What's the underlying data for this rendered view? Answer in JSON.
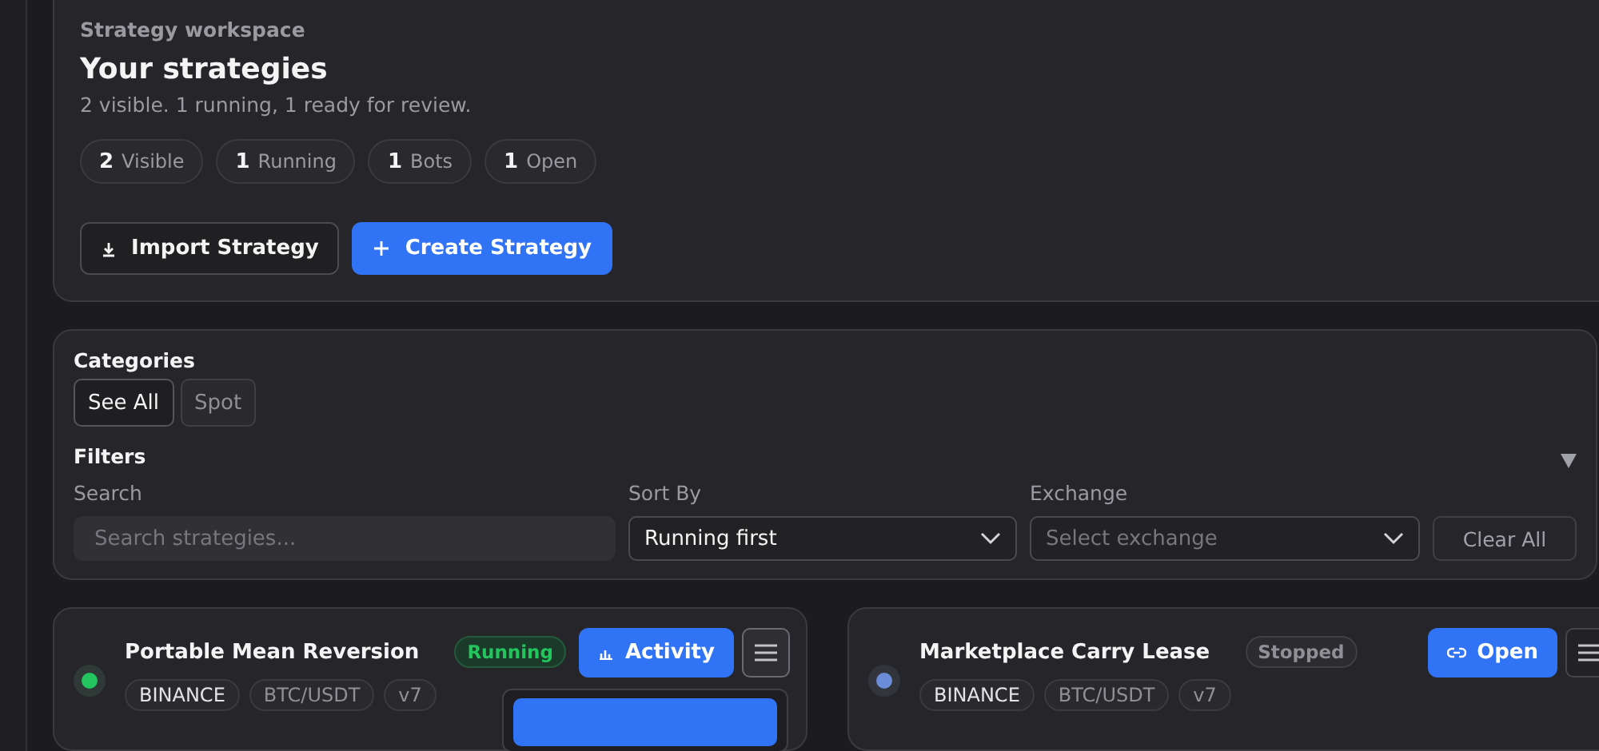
{
  "header": {
    "eyebrow": "Strategy workspace",
    "title": "Your strategies",
    "subtitle": "2 visible. 1 running, 1 ready for review.",
    "stats": [
      {
        "count": "2",
        "label": "Visible"
      },
      {
        "count": "1",
        "label": "Running"
      },
      {
        "count": "1",
        "label": "Bots"
      },
      {
        "count": "1",
        "label": "Open"
      }
    ],
    "buttons": [
      {
        "label": "Import Strategy",
        "kind": "import"
      },
      {
        "label": "Create Strategy",
        "kind": "create"
      }
    ]
  },
  "filters": {
    "categories_title": "Categories",
    "categories": [
      {
        "label": "See All",
        "selected": true
      },
      {
        "label": "Spot",
        "selected": false
      }
    ],
    "filters_title": "Filters",
    "expanded": true,
    "search": {
      "label": "Search",
      "placeholder": "Search strategies..."
    },
    "sort": {
      "label": "Sort By",
      "value": "Running first"
    },
    "exchange": {
      "label": "Exchange",
      "placeholder": "Select exchange"
    },
    "clear": "Clear All"
  },
  "strategies": [
    {
      "name": "Portable Mean Reversion",
      "status": "Running",
      "kind": "running",
      "color": "#22c55e",
      "action": {
        "label": "Activity",
        "kind": "activity"
      },
      "tags": [
        "BINANCE",
        "BTC/USDT",
        "v7"
      ],
      "menu_open": true
    },
    {
      "name": "Marketplace Carry Lease",
      "status": "Stopped",
      "kind": "stopped",
      "color": "#6b8cd6",
      "action": {
        "label": "Open",
        "kind": "open"
      },
      "tags": [
        "BINANCE",
        "BTC/USDT",
        "v7"
      ],
      "menu_open": false
    }
  ]
}
